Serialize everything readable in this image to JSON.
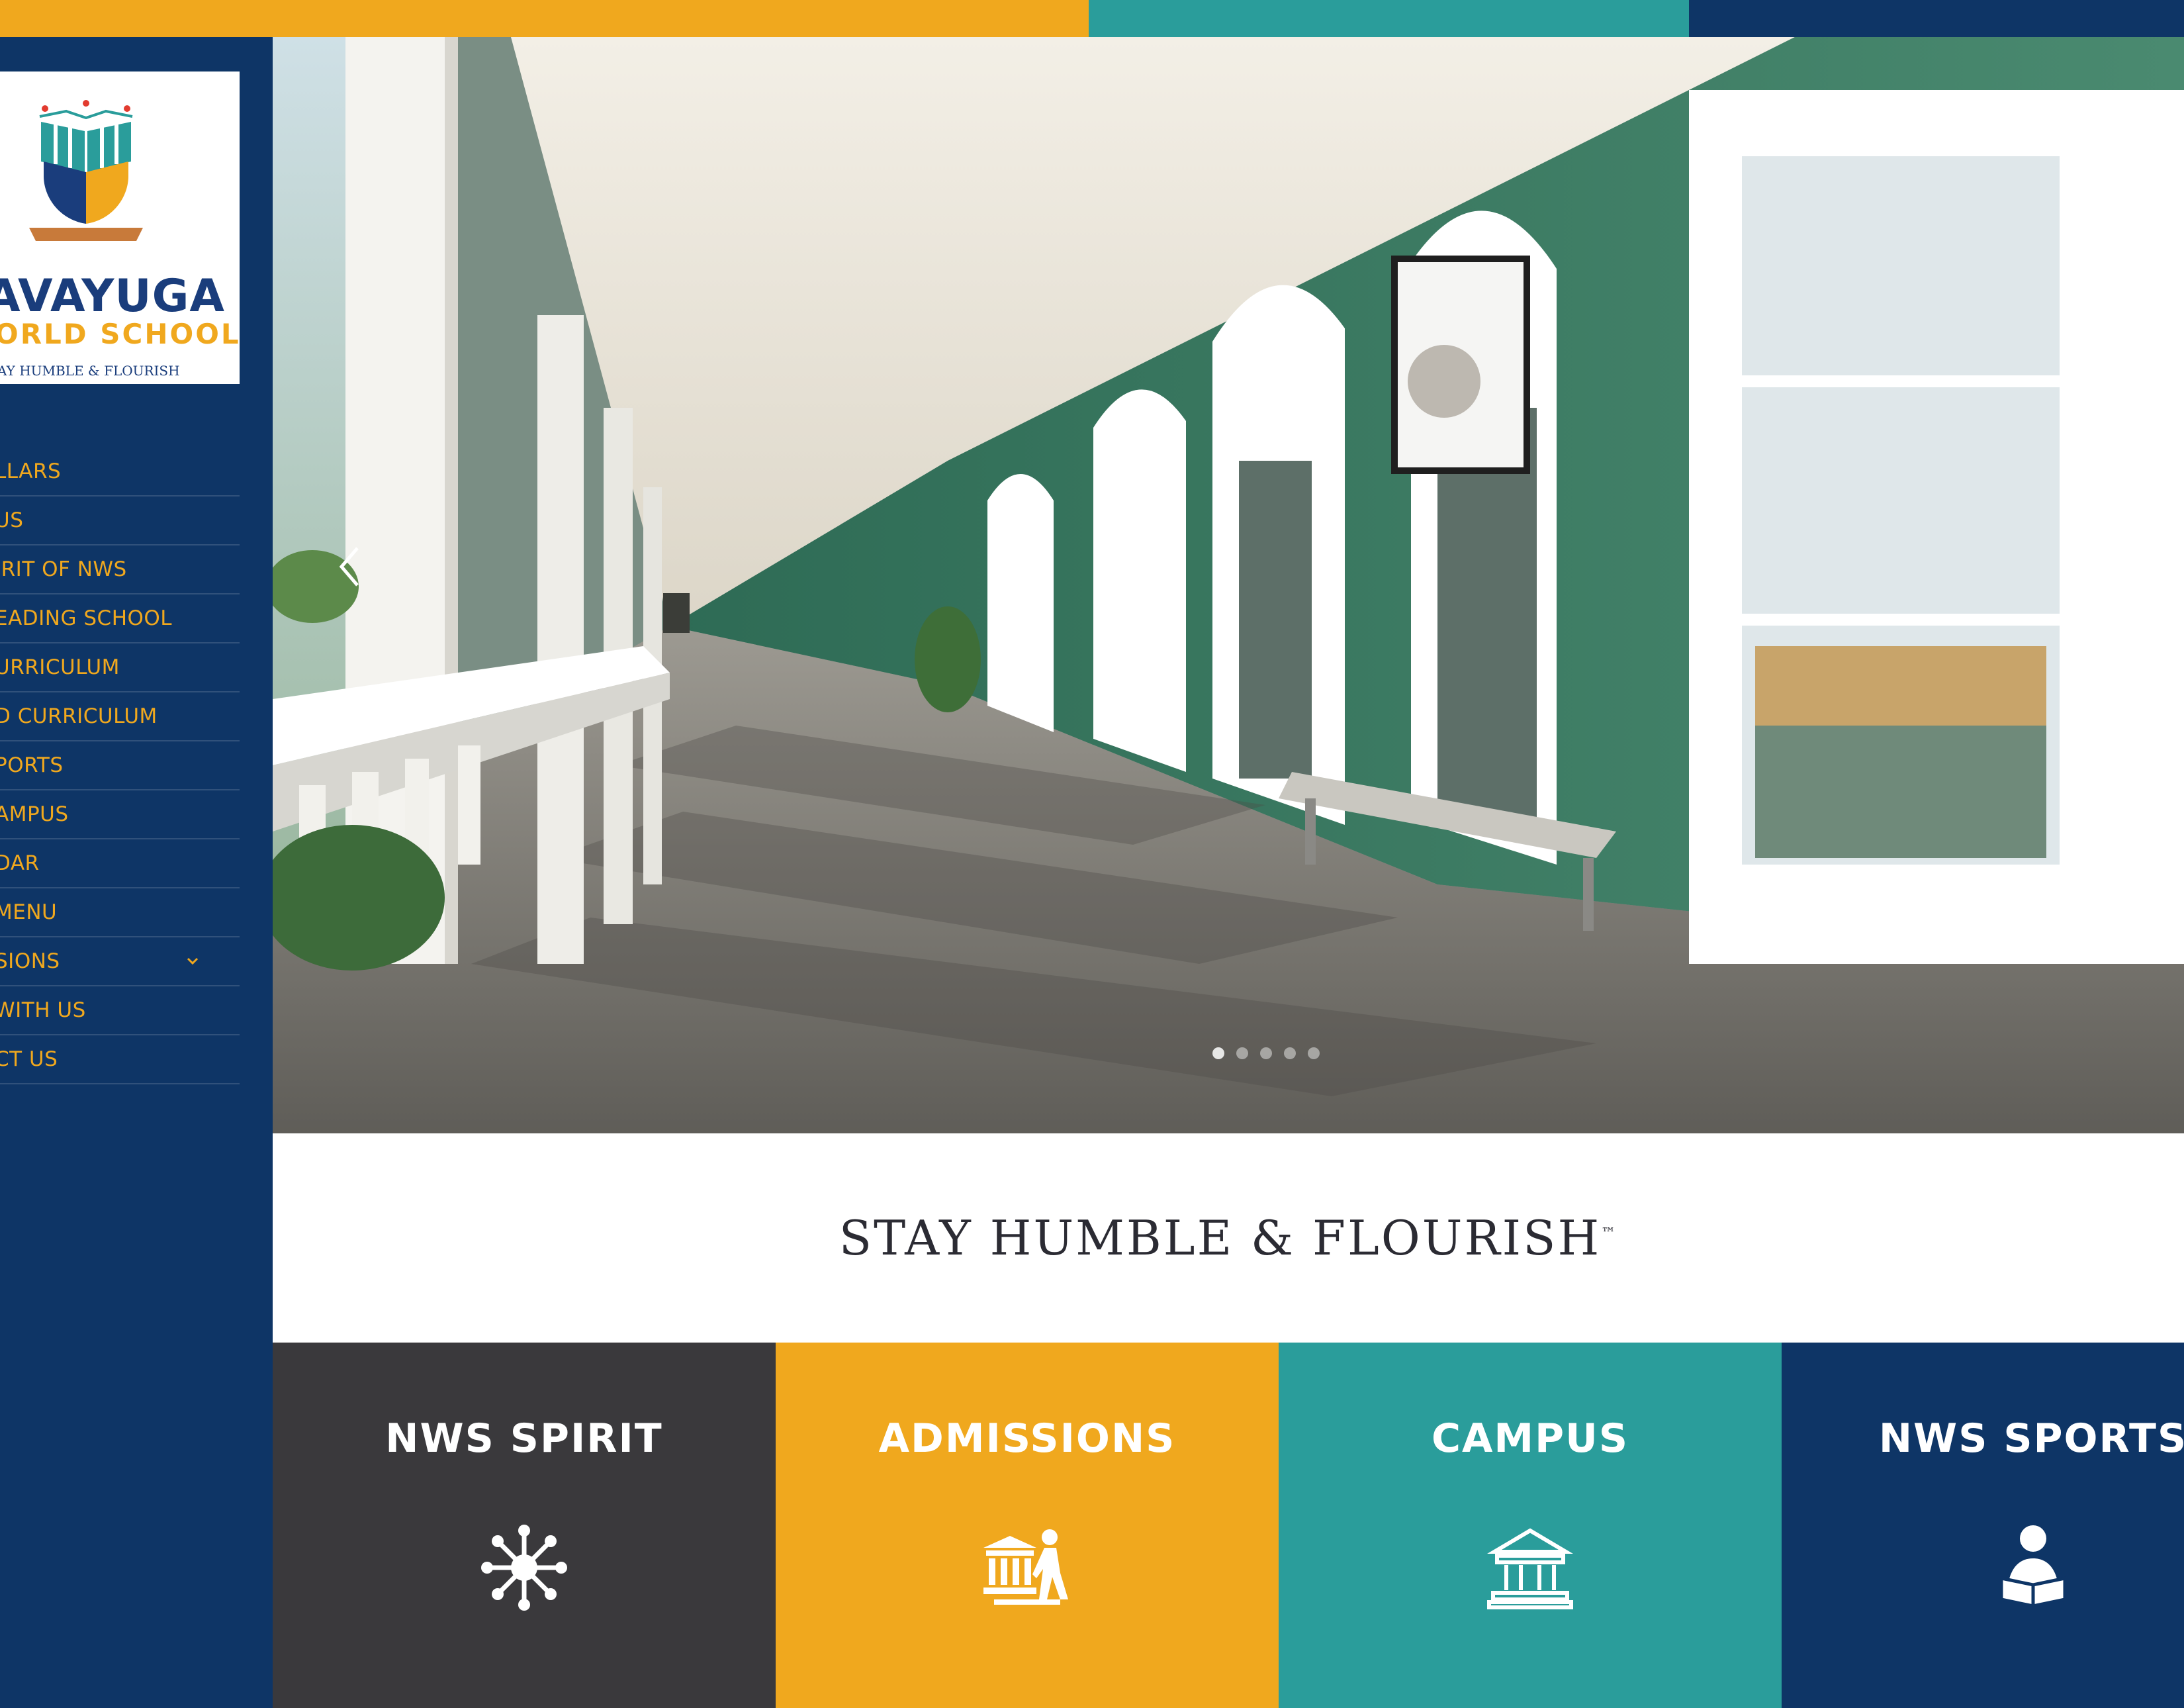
{
  "colors": {
    "navy": "#0e3566",
    "orange": "#f0a81e",
    "teal": "#2a9d9b",
    "charcoal": "#3a393c",
    "logo_blue": "#1a3d7c",
    "logo_gold": "#f0a81e",
    "menu_text": "#f0a81e",
    "wall_green": "#3f8468"
  },
  "logo": {
    "line1": "AVAYUGA",
    "line2": "ORLD SCHOOL",
    "line3": "AY HUMBLE & FLOURISH",
    "emblem_icon": "book-shield-emblem-icon"
  },
  "menu": {
    "items": [
      {
        "label": "LLARS"
      },
      {
        "label": "US"
      },
      {
        "label": "IRIT OF NWS"
      },
      {
        "label": "EADING SCHOOL"
      },
      {
        "label": "URRICULUM"
      },
      {
        "label": "D CURRICULUM"
      },
      {
        "label": "PORTS"
      },
      {
        "label": "AMPUS"
      },
      {
        "label": "DAR"
      },
      {
        "label": "MENU"
      },
      {
        "label": "SIONS",
        "has_submenu": true,
        "icon": "chevron-down-icon"
      },
      {
        "label": "WITH US"
      },
      {
        "label": "CT US"
      }
    ]
  },
  "hero": {
    "prev_icon": "chevron-left-icon",
    "slide_count": 5,
    "active_slide": 1
  },
  "tagline": {
    "text": "STAY HUMBLE & FLOURISH",
    "mark": "™"
  },
  "tiles": [
    {
      "label": "NWS SPIRIT",
      "icon": "network-hub-icon",
      "color": "#3a393c"
    },
    {
      "label": "ADMISSIONS",
      "icon": "school-walker-icon",
      "color": "#f0a81e"
    },
    {
      "label": "CAMPUS",
      "icon": "institution-building-icon",
      "color": "#2a9d9b"
    },
    {
      "label": "NWS SPORTS",
      "icon": "reading-person-icon",
      "color": "#0e3566"
    }
  ]
}
